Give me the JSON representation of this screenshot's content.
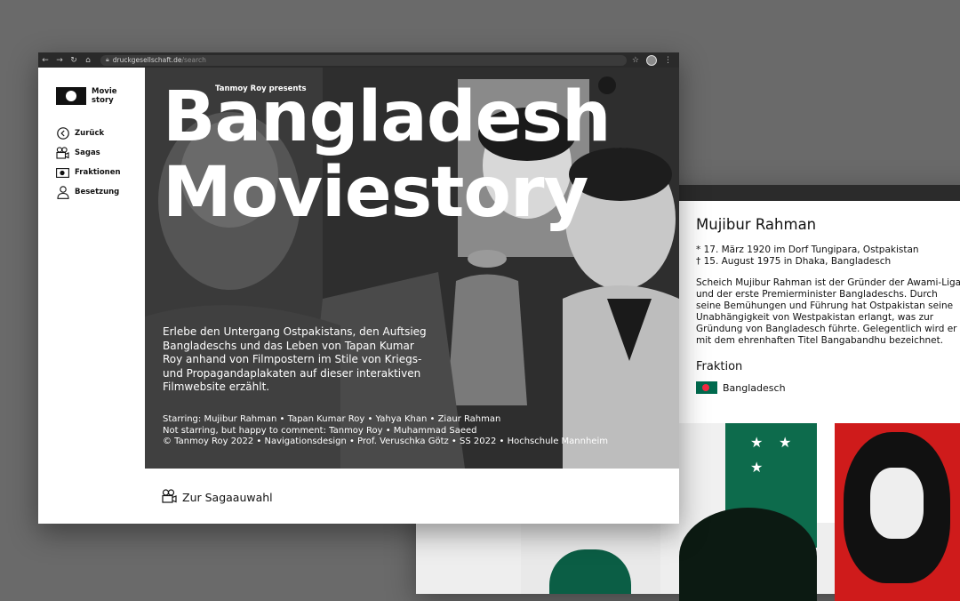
{
  "browser": {
    "url_host": "druckgesellschaft.de",
    "url_path": "/search"
  },
  "sidebar": {
    "logo_line1": "Movie",
    "logo_line2": "story",
    "items": [
      {
        "label": "Zurück"
      },
      {
        "label": "Sagas"
      },
      {
        "label": "Fraktionen"
      },
      {
        "label": "Besetzung"
      }
    ]
  },
  "hero": {
    "presents": "Tanmoy Roy presents",
    "title_line1": "Bangladesh",
    "title_line2": "Moviestory",
    "description": "Erlebe den Untergang Ostpakistans, den Auftsieg Bangladeschs und das Leben von Tapan Kumar Roy anhand von Filmpostern im Stile von Kriegs- und Propagandaplakaten auf dieser interaktiven Filmwebsite erzählt.",
    "credits": [
      "Starring: Mujibur Rahman • Tapan Kumar Roy • Yahya Khan • Ziaur Rahman",
      "Not starring, but happy to comment: Tanmoy Roy • Muhammad Saeed",
      "© Tanmoy Roy 2022 • Navigationsdesign • Prof. Veruschka Götz • SS 2022 • Hochschule Mannheim"
    ]
  },
  "saga_button": {
    "label": "Zur Sagaauwahl"
  },
  "profile": {
    "name": "Mujibur Rahman",
    "born": "* 17. März 1920 im Dorf Tungipara, Ostpakistan",
    "died": "† 15. August 1975 in Dhaka, Bangladesch",
    "bio": "Scheich Mujibur Rahman ist der Gründer der Awami-Liga und der erste Premierminister Bangladeschs. Durch seine Bemühungen und Führung hat Ostpakistan seine Unabhängigkeit von Westpakistan erlangt, was zur Gründung von Bangladesch führte.  Gelegentlich wird er mit dem ehrenhaften Titel Bangabandhu bezeichnet.",
    "faction_heading": "Fraktion",
    "faction_name": "Bangladesch"
  },
  "colors": {
    "page_background": "#6a6a6a",
    "hero_background": "#2c2c2c",
    "bangladesh_green": "#006a4e",
    "bangladesh_red": "#f42a41",
    "poster_red": "#cf1b1b"
  },
  "icons": {
    "back": "arrow-left-circle-icon",
    "sagas": "film-camera-icon",
    "factions": "flag-icon",
    "cast": "person-icon"
  }
}
